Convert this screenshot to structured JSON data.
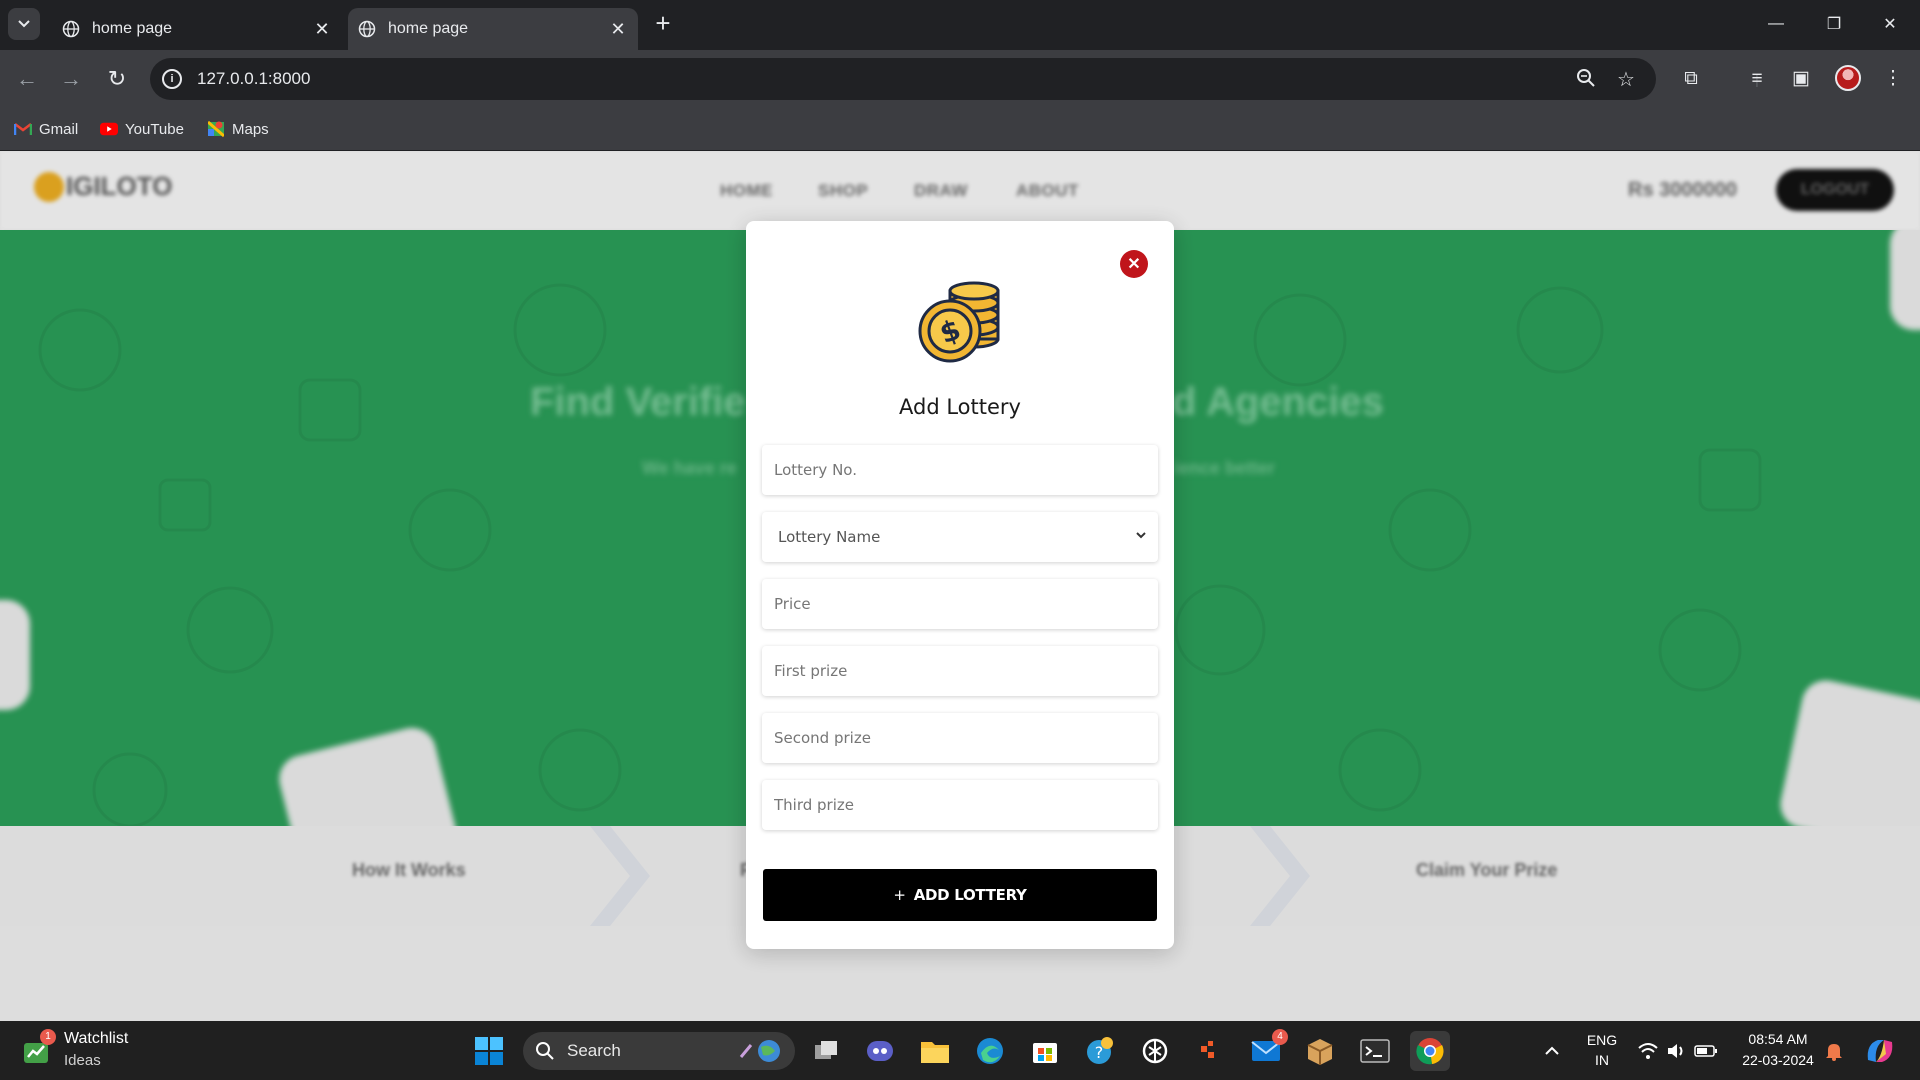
{
  "browser": {
    "tabs": [
      {
        "title": "home page",
        "active": false
      },
      {
        "title": "home page",
        "active": true
      }
    ],
    "new_tab_label": "+",
    "url": "127.0.0.1:8000",
    "bookmarks": [
      {
        "label": "Gmail",
        "icon": "gmail-icon"
      },
      {
        "label": "YouTube",
        "icon": "youtube-icon"
      },
      {
        "label": "Maps",
        "icon": "maps-icon"
      }
    ]
  },
  "site": {
    "logo_text": "IGILOTO",
    "nav": [
      "HOME",
      "SHOP",
      "DRAW",
      "ABOUT"
    ],
    "balance": "Rs 3000000",
    "logout_label": "LOGOUT",
    "hero_title_left": "Find Verifie",
    "hero_title_right": "d Agencies",
    "hero_sub_left": "We have re",
    "hero_sub_right": "ience better",
    "steps": [
      "How It Works",
      "F",
      "Claim Your Prize"
    ],
    "colors": {
      "hero_green": "#2a9a57",
      "accent_yellow": "#e6a921"
    }
  },
  "modal": {
    "title": "Add Lottery",
    "fields": {
      "lottery_no_placeholder": "Lottery No.",
      "lottery_name_selected": "Lottery Name",
      "price_placeholder": "Price",
      "first_prize_placeholder": "First prize",
      "second_prize_placeholder": "Second prize",
      "third_prize_placeholder": "Third prize"
    },
    "submit_label": "ADD LOTTERY",
    "close_color": "#c0151b"
  },
  "taskbar": {
    "widget_title": "Watchlist",
    "widget_sub": "Ideas",
    "widget_badge": "1",
    "search_label": "Search",
    "mail_badge": "4",
    "lang_top": "ENG",
    "lang_bottom": "IN",
    "time": "08:54 AM",
    "date": "22-03-2024"
  }
}
